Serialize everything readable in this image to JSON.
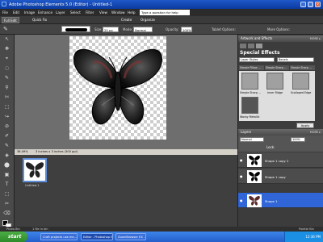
{
  "window": {
    "title": "Adobe Photoshop Elements 5.0 (Editor) - Untitled-1",
    "buttons": [
      "_",
      "□",
      "×"
    ]
  },
  "menu": {
    "items": [
      "File",
      "Edit",
      "Image",
      "Enhance",
      "Layer",
      "Select",
      "Filter",
      "View",
      "Window",
      "Help"
    ],
    "question_placeholder": "Type a question for help"
  },
  "shortcuts": {
    "full_edit": "Full Edit",
    "quick_fix": "Quick Fix",
    "create": "Create",
    "organize": "Organize"
  },
  "options": {
    "size_label": "Size:",
    "size_value": "20 px",
    "mode_label": "Mode:",
    "mode_value": "Normal",
    "opacity_label": "Opacity:",
    "opacity_value": "100%",
    "tablet_options": "Tablet Options:",
    "more_options": "More Options:"
  },
  "tools": [
    "↖",
    "✥",
    "⌖",
    "◌",
    "✎",
    "⚲",
    "✄",
    "⬚",
    "↪",
    "⊘",
    "✐",
    "✎",
    "◈",
    "⬤",
    "▣",
    "T",
    "⬚",
    "✂",
    "⌫"
  ],
  "colors": {
    "foreground": "#000000",
    "background": "#ffffff",
    "accent": "#3066d8"
  },
  "document": {
    "zoom": "36.49%",
    "dimensions": "3 inches x 3 inches (300 ppi)"
  },
  "bin": {
    "thumb_label": "Untitled-1"
  },
  "artwork_panel": {
    "header": "Artwork and Effects",
    "more": "MORE ▸",
    "section_title": "Special Effects",
    "dropdown1": "Layer Styles",
    "dropdown2": "Bevels",
    "tabs": [
      "Simple Pillow ...",
      "Simple Sharp ...",
      "Simple Sharp ..."
    ],
    "effects": [
      {
        "label": "Simple Sharp ..."
      },
      {
        "label": "Inner Ridge"
      },
      {
        "label": "Scalloped Edge"
      },
      {
        "label": "Wacky Metallic"
      }
    ],
    "apply": "Apply"
  },
  "layers_panel": {
    "header": "Layers",
    "more": "MORE ▸",
    "blend_mode": "Normal",
    "opacity": "100%",
    "lock_label": "Lock:",
    "layers": [
      {
        "name": "Shape 1 copy 2",
        "selected": false
      },
      {
        "name": "Shape 1 copy",
        "selected": false
      },
      {
        "name": "Shape 1",
        "selected": true
      }
    ]
  },
  "photo_bin_bar": {
    "label": "Photo Bin",
    "files_label": "1 file in bin",
    "right_label": "Palette Bin"
  },
  "taskbar": {
    "start": "start",
    "tasks": [
      "Craft projects use me...",
      "Editor - Photoshop El...",
      "ZoomBrowser EX - C..."
    ],
    "clock": "12:36 PM"
  }
}
